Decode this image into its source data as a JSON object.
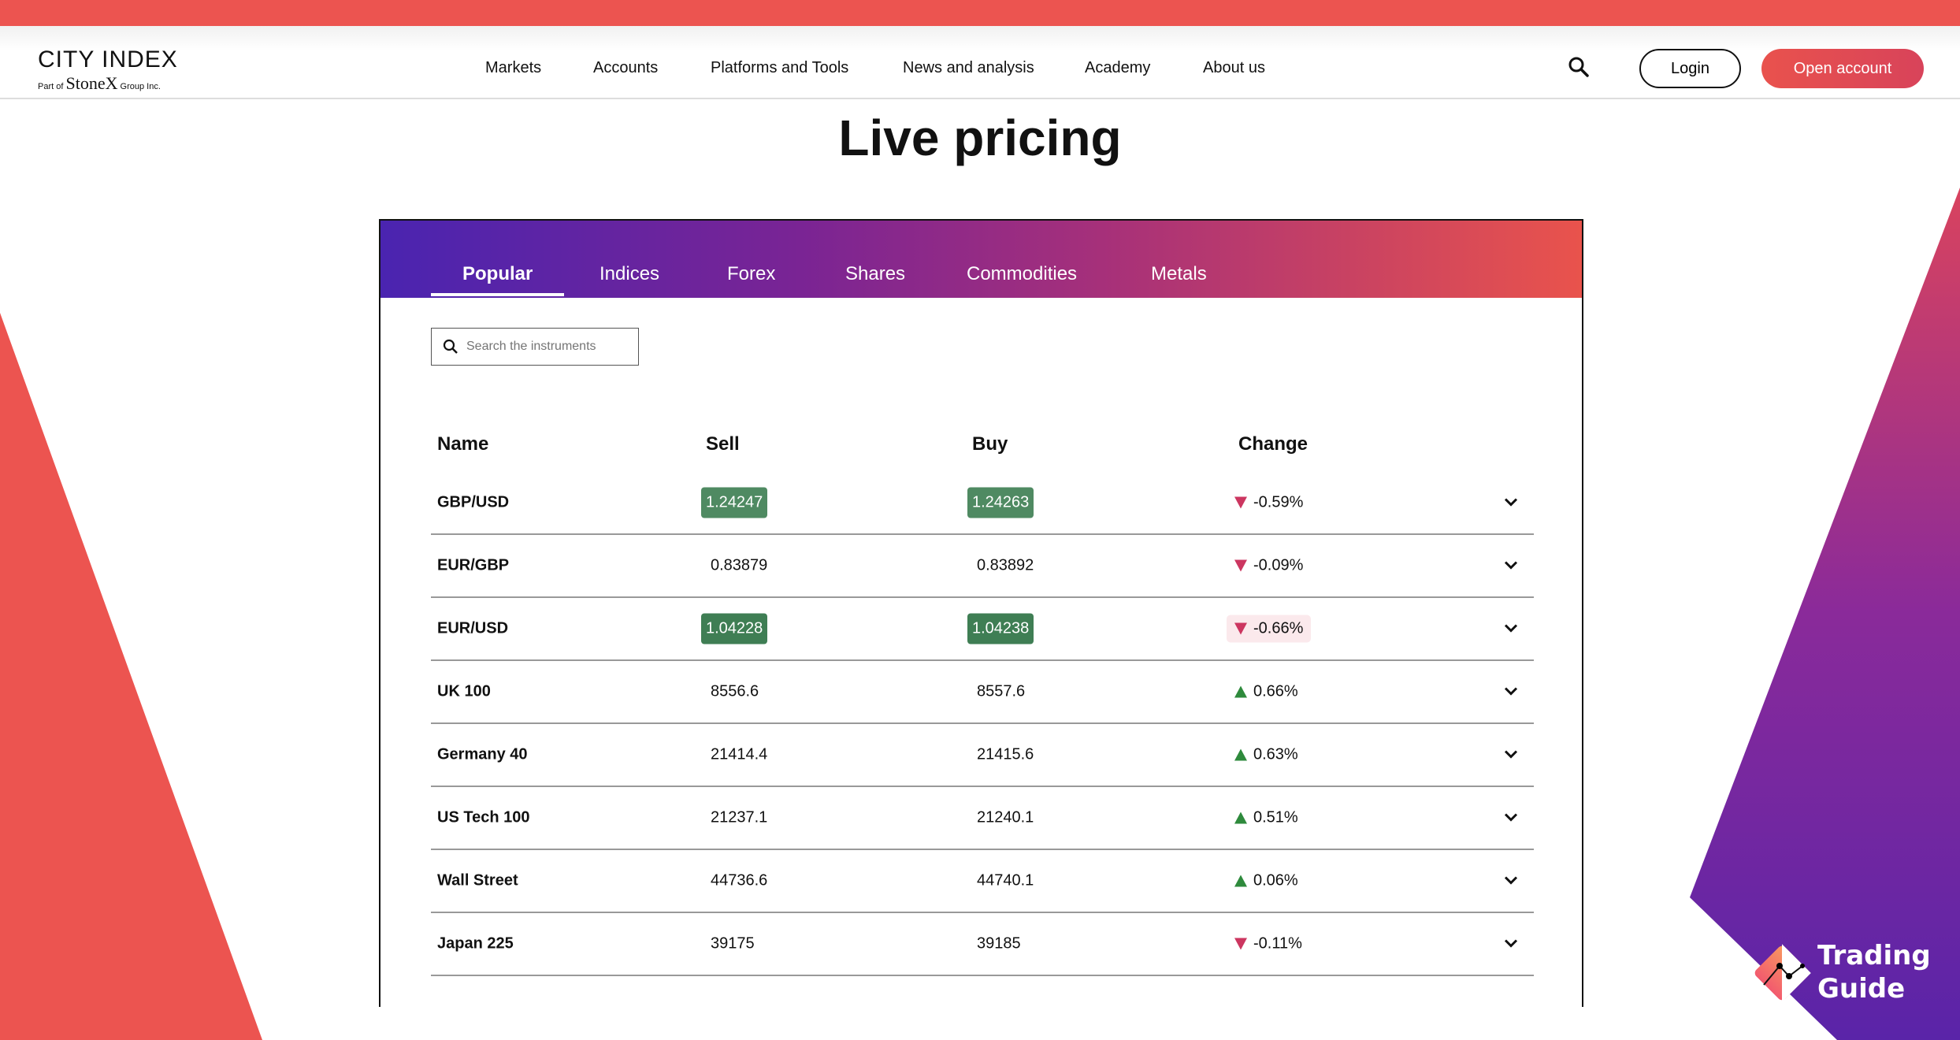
{
  "header": {
    "logo_main": "CITY INDEX",
    "logo_sub_prefix": "Part of",
    "logo_sub_brand": "StoneX",
    "logo_sub_suffix": "Group Inc.",
    "nav": [
      "Markets",
      "Accounts",
      "Platforms and Tools",
      "News and analysis",
      "Academy",
      "About us"
    ],
    "login": "Login",
    "open_account": "Open account"
  },
  "title": "Live pricing",
  "tabs": [
    "Popular",
    "Indices",
    "Forex",
    "Shares",
    "Commodities",
    "Metals"
  ],
  "active_tab": "Popular",
  "search": {
    "placeholder": "Search the instruments"
  },
  "columns": [
    "Name",
    "Sell",
    "Buy",
    "Change"
  ],
  "rows": [
    {
      "name": "GBP/USD",
      "sell": "1.24247",
      "buy": "1.24263",
      "change": "-0.59%",
      "direction": "down"
    },
    {
      "name": "EUR/GBP",
      "sell": "0.83879",
      "buy": "0.83892",
      "change": "-0.09%",
      "direction": "down"
    },
    {
      "name": "EUR/USD",
      "sell": "1.04228",
      "buy": "1.04238",
      "change": "-0.66%",
      "direction": "down"
    },
    {
      "name": "UK 100",
      "sell": "8556.6",
      "buy": "8557.6",
      "change": "0.66%",
      "direction": "up"
    },
    {
      "name": "Germany 40",
      "sell": "21414.4",
      "buy": "21415.6",
      "change": "0.63%",
      "direction": "up"
    },
    {
      "name": "US Tech 100",
      "sell": "21237.1",
      "buy": "21240.1",
      "change": "0.51%",
      "direction": "up"
    },
    {
      "name": "Wall Street",
      "sell": "44736.6",
      "buy": "44740.1",
      "change": "0.06%",
      "direction": "up"
    },
    {
      "name": "Japan 225",
      "sell": "39175",
      "buy": "39185",
      "change": "-0.11%",
      "direction": "down"
    }
  ],
  "watermark": {
    "line1": "Trading",
    "line2": "Guide"
  },
  "colors": {
    "brand_red": "#ec5450",
    "up": "#2e8a3c",
    "down": "#cc3660",
    "price_highlight": "#4f8a62"
  }
}
